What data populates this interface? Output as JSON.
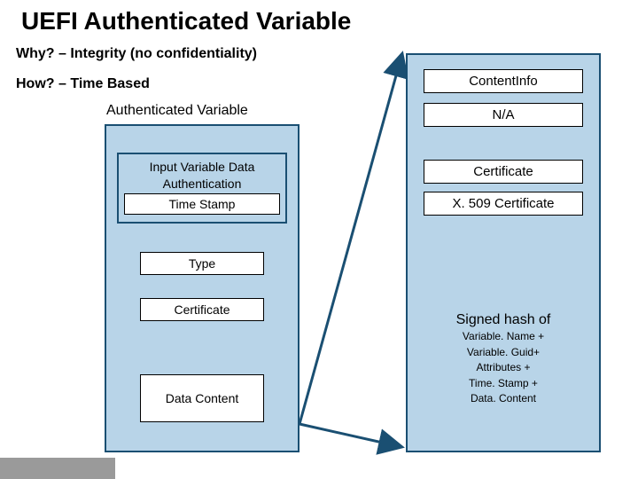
{
  "title": "UEFI Authenticated Variable",
  "subtitles": {
    "why": "Why? – Integrity (no confidentiality)",
    "how": "How? – Time Based"
  },
  "left": {
    "label": "Authenticated Variable",
    "auth_group": {
      "line1": "Input Variable Data",
      "line2": "Authentication",
      "inner": "Time Stamp"
    },
    "type": "Type",
    "certificate": "Certificate",
    "data_content": "Data Content"
  },
  "right": {
    "content_info": "ContentInfo",
    "na": "N/A",
    "certificate": "Certificate",
    "x509": "X. 509 Certificate",
    "signed_hash": {
      "header": "Signed hash of",
      "lines": [
        "Variable. Name +",
        "Variable. Guid+",
        "Attributes +",
        "Time. Stamp +",
        "Data. Content"
      ]
    }
  },
  "colors": {
    "box_fill": "#b8d4e8",
    "box_border": "#1a4f72",
    "arrow": "#1a4f72"
  }
}
